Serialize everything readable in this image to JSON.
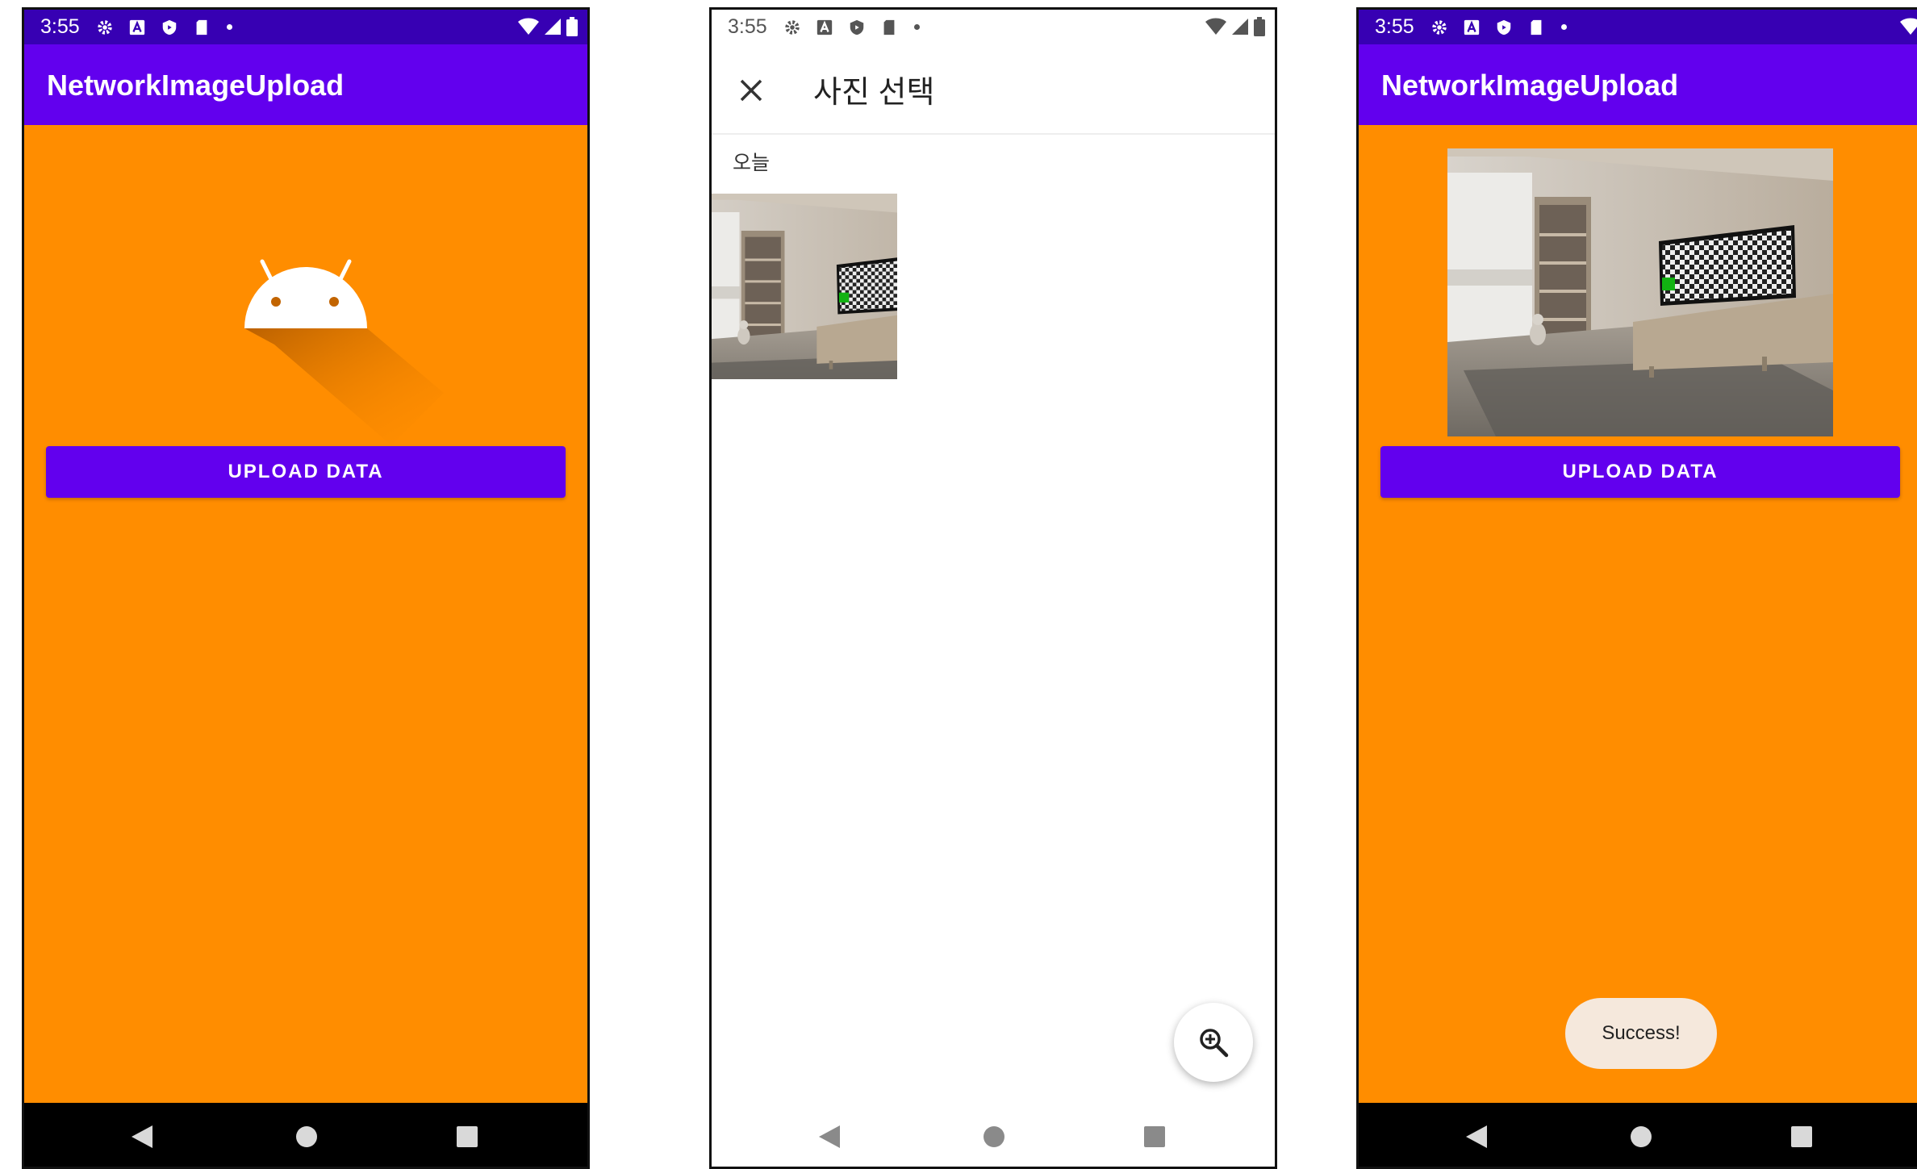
{
  "colors": {
    "status_dark": "#3700b3",
    "primary": "#6200ee",
    "background_orange": "#ff8d00",
    "toast_bg": "#f5e8dc"
  },
  "screens": [
    {
      "status": {
        "time": "3:55",
        "icons": [
          "gear-icon",
          "a-icon",
          "shield-icon",
          "sd-card-icon",
          "dot-icon",
          "wifi-icon",
          "signal-icon",
          "battery-icon"
        ]
      },
      "app_title": "NetworkImageUpload",
      "image": "android-robot-icon",
      "upload_button": "UPLOAD DATA",
      "nav": [
        "back-icon",
        "home-icon",
        "recents-icon"
      ]
    },
    {
      "status": {
        "time": "3:55",
        "icons": [
          "gear-icon",
          "a-icon",
          "shield-icon",
          "sd-card-icon",
          "dot-icon",
          "wifi-icon",
          "signal-icon",
          "battery-icon"
        ]
      },
      "picker_title": "사진 선택",
      "section_label": "오늘",
      "photos": [
        "living-room-photo"
      ],
      "fab": "zoom-in-icon",
      "nav": [
        "back-icon",
        "home-icon",
        "recents-icon"
      ]
    },
    {
      "status": {
        "time": "3:55",
        "icons": [
          "gear-icon",
          "a-icon",
          "shield-icon",
          "sd-card-icon",
          "dot-icon",
          "wifi-icon",
          "signal-icon",
          "battery-icon"
        ]
      },
      "app_title": "NetworkImageUpload",
      "image": "living-room-photo",
      "upload_button": "UPLOAD DATA",
      "toast": "Success!",
      "nav": [
        "back-icon",
        "home-icon",
        "recents-icon"
      ]
    }
  ]
}
